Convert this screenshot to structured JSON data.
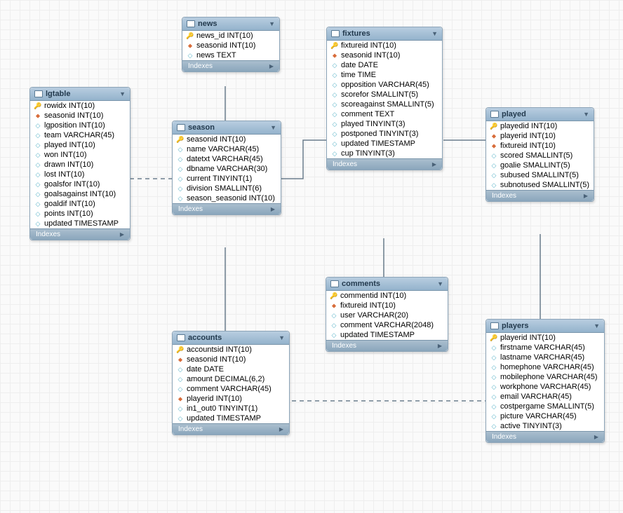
{
  "entities": {
    "lgtable": {
      "title": "lgtable",
      "footer": "Indexes",
      "fields": [
        {
          "icon": "key",
          "label": "rowidx INT(10)"
        },
        {
          "icon": "fkey",
          "label": "seasonid INT(10)"
        },
        {
          "icon": "col",
          "label": "lgposition INT(10)"
        },
        {
          "icon": "col",
          "label": "team VARCHAR(45)"
        },
        {
          "icon": "col",
          "label": "played INT(10)"
        },
        {
          "icon": "col",
          "label": "won INT(10)"
        },
        {
          "icon": "col",
          "label": "drawn INT(10)"
        },
        {
          "icon": "col",
          "label": "lost INT(10)"
        },
        {
          "icon": "col",
          "label": "goalsfor INT(10)"
        },
        {
          "icon": "col",
          "label": "goalsagainst INT(10)"
        },
        {
          "icon": "col",
          "label": "goaldif INT(10)"
        },
        {
          "icon": "col",
          "label": "points INT(10)"
        },
        {
          "icon": "col",
          "label": "updated TIMESTAMP"
        }
      ]
    },
    "news": {
      "title": "news",
      "footer": "Indexes",
      "fields": [
        {
          "icon": "key",
          "label": "news_id INT(10)"
        },
        {
          "icon": "fkey",
          "label": "seasonid INT(10)"
        },
        {
          "icon": "col",
          "label": "news TEXT"
        }
      ]
    },
    "season": {
      "title": "season",
      "footer": "Indexes",
      "fields": [
        {
          "icon": "key",
          "label": "seasonid INT(10)"
        },
        {
          "icon": "col",
          "label": "name VARCHAR(45)"
        },
        {
          "icon": "col",
          "label": "datetxt VARCHAR(45)"
        },
        {
          "icon": "col",
          "label": "dbname VARCHAR(30)"
        },
        {
          "icon": "col",
          "label": "current TINYINT(1)"
        },
        {
          "icon": "col",
          "label": "division SMALLINT(6)"
        },
        {
          "icon": "col",
          "label": "season_seasonid INT(10)"
        }
      ]
    },
    "fixtures": {
      "title": "fixtures",
      "footer": "Indexes",
      "fields": [
        {
          "icon": "key",
          "label": "fixtureid INT(10)"
        },
        {
          "icon": "fkey",
          "label": "seasonid INT(10)"
        },
        {
          "icon": "col",
          "label": "date DATE"
        },
        {
          "icon": "col",
          "label": "time TIME"
        },
        {
          "icon": "col",
          "label": "opposition VARCHAR(45)"
        },
        {
          "icon": "col",
          "label": "scorefor SMALLINT(5)"
        },
        {
          "icon": "col",
          "label": "scoreagainst SMALLINT(5)"
        },
        {
          "icon": "col",
          "label": "comment TEXT"
        },
        {
          "icon": "col",
          "label": "played TINYINT(3)"
        },
        {
          "icon": "col",
          "label": "postponed TINYINT(3)"
        },
        {
          "icon": "col",
          "label": "updated TIMESTAMP"
        },
        {
          "icon": "col",
          "label": "cup TINYINT(3)"
        }
      ]
    },
    "played": {
      "title": "played",
      "footer": "Indexes",
      "fields": [
        {
          "icon": "key",
          "label": "playedid INT(10)"
        },
        {
          "icon": "fkey",
          "label": "playerid INT(10)"
        },
        {
          "icon": "fkey",
          "label": "fixtureid INT(10)"
        },
        {
          "icon": "col",
          "label": "scored SMALLINT(5)"
        },
        {
          "icon": "col",
          "label": "goalie SMALLINT(5)"
        },
        {
          "icon": "col",
          "label": "subused SMALLINT(5)"
        },
        {
          "icon": "col",
          "label": "subnotused SMALLINT(5)"
        }
      ]
    },
    "comments": {
      "title": "comments",
      "footer": "Indexes",
      "fields": [
        {
          "icon": "key",
          "label": "commentid INT(10)"
        },
        {
          "icon": "fkey",
          "label": "fixtureid INT(10)"
        },
        {
          "icon": "col",
          "label": "user VARCHAR(20)"
        },
        {
          "icon": "col",
          "label": "comment VARCHAR(2048)"
        },
        {
          "icon": "col",
          "label": "updated TIMESTAMP"
        }
      ]
    },
    "accounts": {
      "title": "accounts",
      "footer": "Indexes",
      "fields": [
        {
          "icon": "key",
          "label": "accountsid INT(10)"
        },
        {
          "icon": "fkey",
          "label": "seasonid INT(10)"
        },
        {
          "icon": "col",
          "label": "date DATE"
        },
        {
          "icon": "col",
          "label": "amount DECIMAL(6,2)"
        },
        {
          "icon": "col",
          "label": "comment VARCHAR(45)"
        },
        {
          "icon": "fkey",
          "label": "playerid INT(10)"
        },
        {
          "icon": "col",
          "label": "in1_out0 TINYINT(1)"
        },
        {
          "icon": "col",
          "label": "updated TIMESTAMP"
        }
      ]
    },
    "players": {
      "title": "players",
      "footer": "Indexes",
      "fields": [
        {
          "icon": "key",
          "label": "playerid INT(10)"
        },
        {
          "icon": "col",
          "label": "firstname VARCHAR(45)"
        },
        {
          "icon": "col",
          "label": "lastname VARCHAR(45)"
        },
        {
          "icon": "col",
          "label": "homephone VARCHAR(45)"
        },
        {
          "icon": "col",
          "label": "mobilephone VARCHAR(45)"
        },
        {
          "icon": "col",
          "label": "workphone VARCHAR(45)"
        },
        {
          "icon": "col",
          "label": "email VARCHAR(45)"
        },
        {
          "icon": "col",
          "label": "costpergame SMALLINT(5)"
        },
        {
          "icon": "col",
          "label": "picture VARCHAR(45)"
        },
        {
          "icon": "col",
          "label": "active TINYINT(3)"
        }
      ]
    }
  },
  "icon_glyphs": {
    "key": "🔑",
    "fkey": "⬥",
    "col": "◇"
  }
}
